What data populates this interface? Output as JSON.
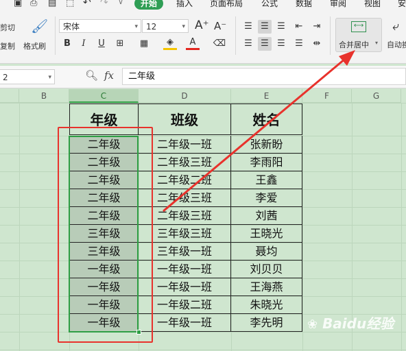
{
  "ribbon": {
    "tabs": [
      "开始",
      "插入",
      "页面布局",
      "公式",
      "数据",
      "审阅",
      "视图",
      "安"
    ],
    "active_tab": "开始",
    "cut_label": "剪切",
    "copy_label": "复制",
    "format_painter_label": "格式刷",
    "font_name": "宋体",
    "font_size": "12",
    "merge_center_label": "合并居中",
    "auto_wrap_label": "自动换"
  },
  "formula_bar": {
    "name_box": "2",
    "fx_label": "fx",
    "content": "二年级"
  },
  "columns": [
    "B",
    "C",
    "D",
    "E",
    "F",
    "G"
  ],
  "active_column": "C",
  "table": {
    "headers": [
      "年级",
      "班级",
      "姓名"
    ],
    "rows": [
      [
        "二年级",
        "二年级一班",
        "张新盼"
      ],
      [
        "二年级",
        "二年级三班",
        "李雨阳"
      ],
      [
        "二年级",
        "二年级二班",
        "王鑫"
      ],
      [
        "二年级",
        "二年级三班",
        "李爱"
      ],
      [
        "二年级",
        "二年级三班",
        "刘茜"
      ],
      [
        "三年级",
        "三年级三班",
        "王晓光"
      ],
      [
        "三年级",
        "三年级一班",
        "聂均"
      ],
      [
        "一年级",
        "一年级一班",
        "刘贝贝"
      ],
      [
        "一年级",
        "一年级一班",
        "王海燕"
      ],
      [
        "一年级",
        "一年级二班",
        "朱晓光"
      ],
      [
        "一年级",
        "一年级一班",
        "李先明"
      ]
    ]
  },
  "watermark": "Baidu经验",
  "colors": {
    "accent": "#2f9e55",
    "annotation": "#e8322c",
    "selection": "#2e9e44"
  }
}
